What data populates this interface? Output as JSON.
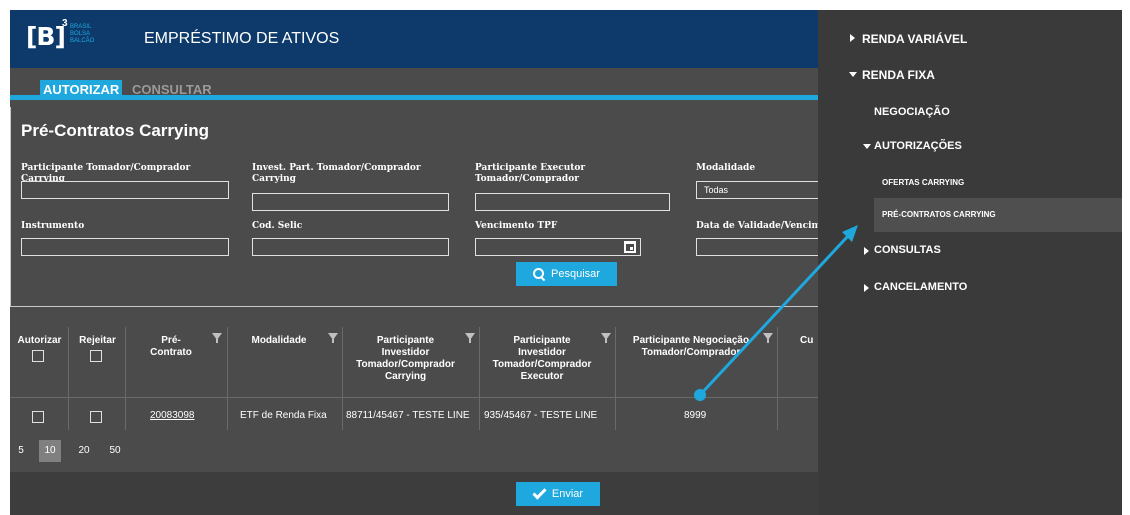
{
  "header": {
    "logo_mark": "[B]",
    "logo_sup": "3",
    "logo_lines": [
      "BRASIL",
      "BOLSA",
      "BALCÃO"
    ],
    "title": "EMPRÉSTIMO DE ATIVOS"
  },
  "tabs": [
    {
      "label": "AUTORIZAR",
      "active": true
    },
    {
      "label": "CONSULTAR",
      "active": false
    }
  ],
  "filters": {
    "title": "Pré-Contratos Carrying",
    "fields": [
      {
        "label": "Participante Tomador/Comprador Carrying",
        "value": ""
      },
      {
        "label": "Invest. Part. Tomador/Comprador Carrying",
        "value": ""
      },
      {
        "label": "Participante Executor Tomador/Comprador",
        "value": ""
      },
      {
        "label": "Modalidade",
        "value": "Todas"
      },
      {
        "label": "Instrumento",
        "value": ""
      },
      {
        "label": "Cod. Selic",
        "value": ""
      },
      {
        "label": "Vencimento TPF",
        "value": ""
      },
      {
        "label": "Data de Validade/Vencime",
        "value": ""
      }
    ],
    "search_label": "Pesquisar"
  },
  "grid": {
    "columns": [
      "Autorizar",
      "Rejeitar",
      "Pré-\nContrato",
      "Modalidade",
      "Participante\nInvestidor\nTomador/Comprador\nCarrying",
      "Participante\nInvestidor\nTomador/Comprador\nExecutor",
      "Participante Negociação\nTomador/Comprador",
      "Cu"
    ],
    "rows": [
      {
        "pre_contrato": "20083098",
        "modalidade": "ETF de Renda Fixa",
        "part_carrying": "88711/45467 - TESTE LINE",
        "part_executor": "935/45467 - TESTE LINE",
        "part_negociacao": "8999"
      }
    ]
  },
  "pager": {
    "sizes": [
      "5",
      "10",
      "20",
      "50"
    ],
    "active": "10"
  },
  "footer": {
    "send_label": "Enviar"
  },
  "menu": {
    "items": [
      {
        "label": "RENDA VARIÁVEL",
        "expanded": false
      },
      {
        "label": "RENDA FIXA",
        "expanded": true
      },
      {
        "label": "NEGOCIAÇÃO"
      },
      {
        "label": "AUTORIZAÇÕES",
        "expanded": true
      },
      {
        "label": "OFERTAS CARRYING"
      },
      {
        "label": "PRÉ-CONTRATOS CARRYING",
        "selected": true
      },
      {
        "label": "CONSULTAS",
        "expanded": false
      },
      {
        "label": "CANCELAMENTO",
        "expanded": false
      }
    ]
  },
  "colors": {
    "accent": "#1ea8de",
    "header_bg": "#0d3a6a",
    "panel_bg": "#4b4b4b",
    "menu_bg": "#3a3a3a"
  }
}
